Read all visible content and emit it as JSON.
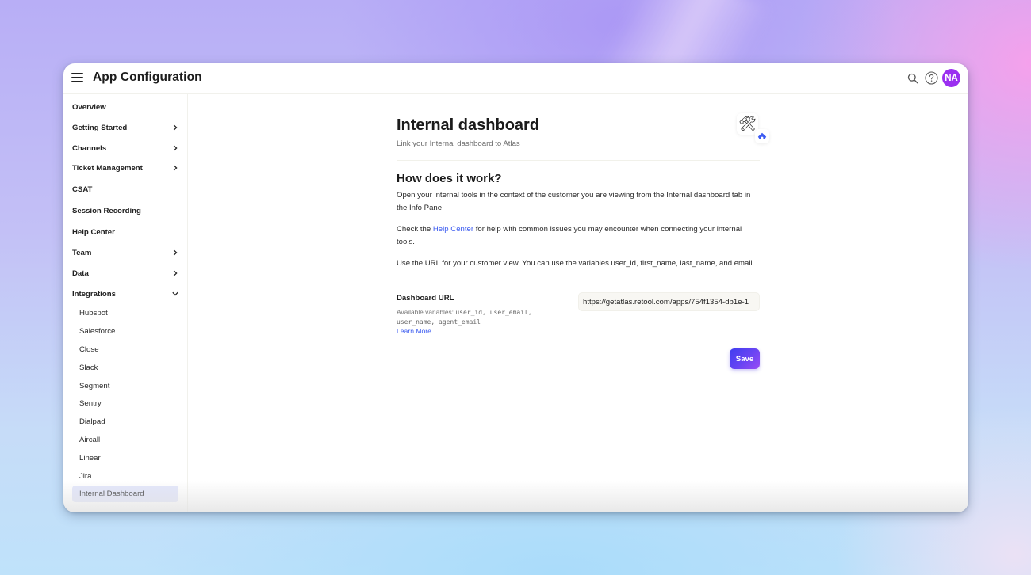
{
  "app": {
    "title": "App Configuration",
    "avatar_initials": "NA",
    "avatar_color": "#9b2ff0"
  },
  "header": {
    "icons": [
      "search-icon",
      "help-icon"
    ]
  },
  "sidebar": {
    "items": [
      {
        "label": "Overview",
        "expandable": false
      },
      {
        "label": "Getting Started",
        "expandable": true,
        "expanded": false
      },
      {
        "label": "Channels",
        "expandable": true,
        "expanded": false
      },
      {
        "label": "Ticket Management",
        "expandable": true,
        "expanded": false
      },
      {
        "label": "CSAT",
        "expandable": false
      },
      {
        "label": "Session Recording",
        "expandable": false
      },
      {
        "label": "Help Center",
        "expandable": false
      },
      {
        "label": "Team",
        "expandable": true,
        "expanded": false
      },
      {
        "label": "Data",
        "expandable": true,
        "expanded": false
      },
      {
        "label": "Integrations",
        "expandable": true,
        "expanded": true
      }
    ],
    "integrations": [
      {
        "label": "Hubspot"
      },
      {
        "label": "Salesforce"
      },
      {
        "label": "Close"
      },
      {
        "label": "Slack"
      },
      {
        "label": "Segment"
      },
      {
        "label": "Sentry"
      },
      {
        "label": "Dialpad"
      },
      {
        "label": "Aircall"
      },
      {
        "label": "Linear"
      },
      {
        "label": "Jira"
      },
      {
        "label": "Internal Dashboard",
        "active": true
      }
    ]
  },
  "main": {
    "title": "Internal dashboard",
    "subtitle": "Link your Internal dashboard to Atlas",
    "logo_icon": "tools-icon",
    "badge_icon": "atlas-logo-icon",
    "section_title": "How does it work?",
    "para1": "Open your internal tools in the context of the customer you are viewing from the Internal dashboard tab in the Info Pane.",
    "para2_before": "Check the ",
    "para2_link": "Help Center",
    "para2_after": " for help with common issues you may encounter when connecting your internal tools.",
    "para3": "Use the URL for your customer view. You can use the variables user_id, first_name, last_name, and email.",
    "field": {
      "label": "Dashboard URL",
      "help_prefix": "Available variables: ",
      "help_vars": "user_id, user_email, user_name, agent_email",
      "learn_more": "Learn More",
      "value": "https://getatlas.retool.com/apps/754f1354-db1e-1"
    },
    "save_label": "Save",
    "accent_color": "#3b5bf0"
  }
}
